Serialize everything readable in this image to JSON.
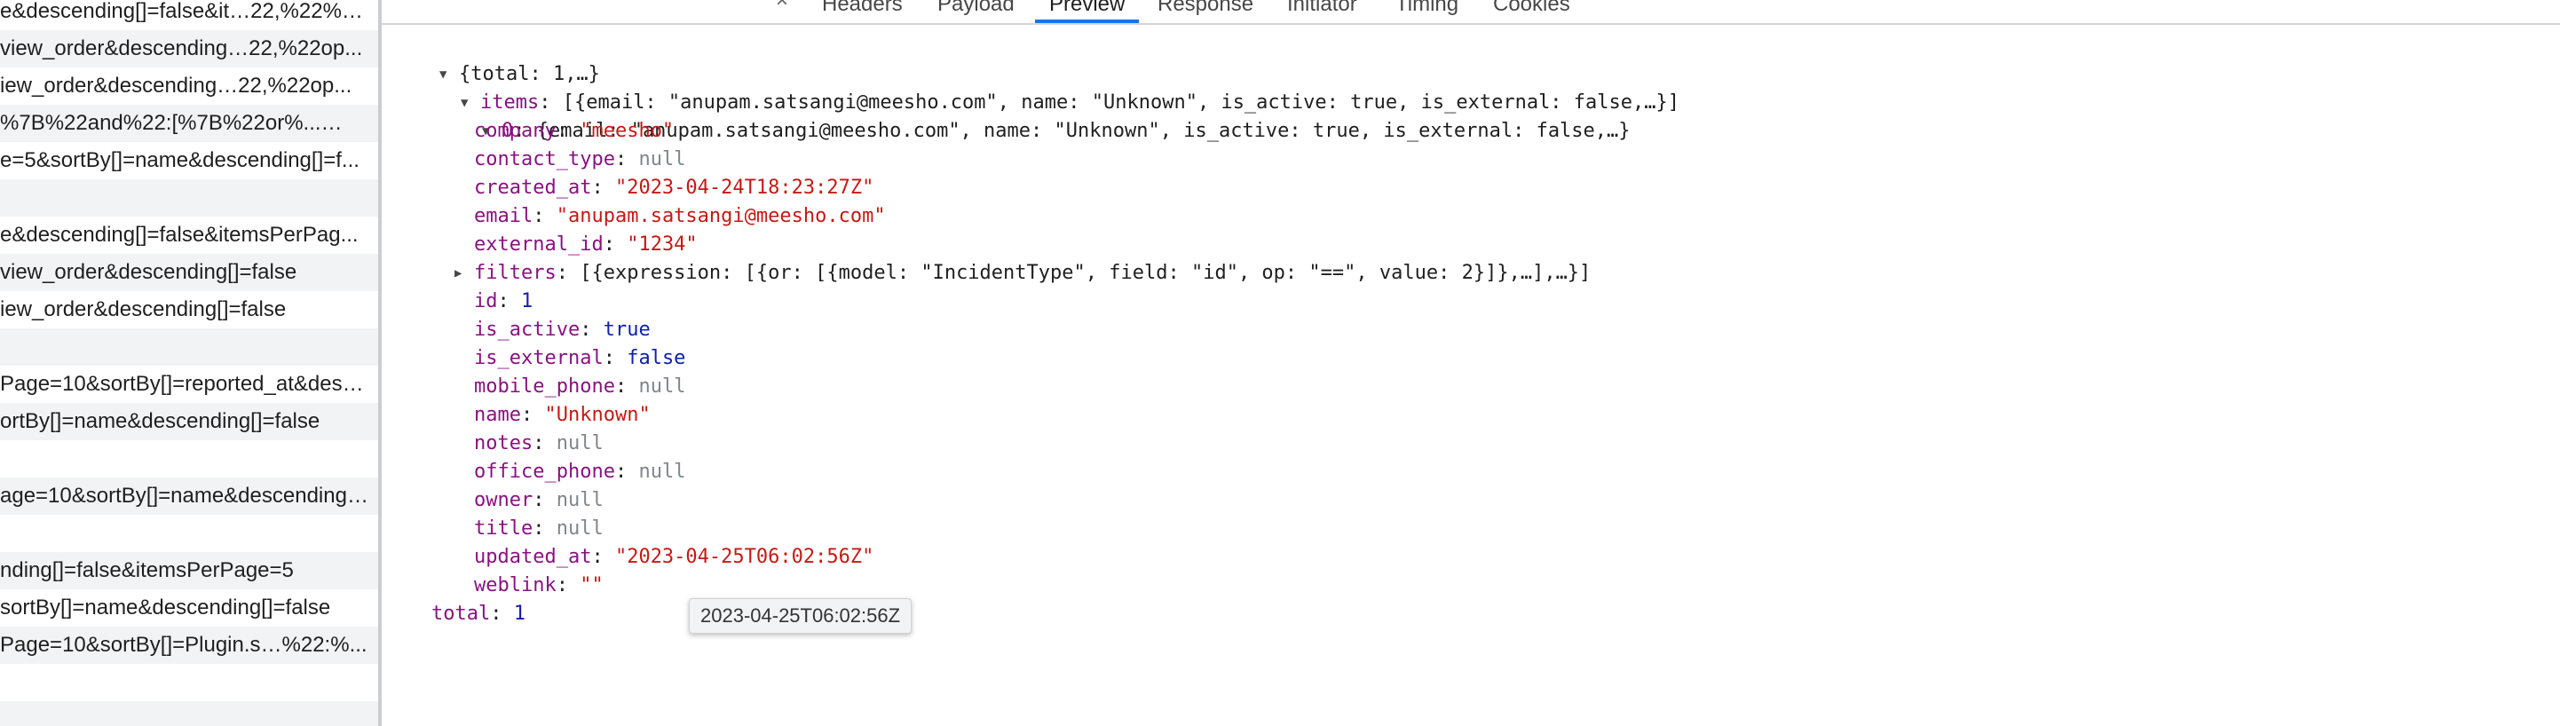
{
  "request_list": [
    {
      "text": "e&descending[]=false&it…22,%22%22%...",
      "stripe": false
    },
    {
      "text": "view_order&descending…22,%22op...",
      "stripe": true
    },
    {
      "text": "iew_order&descending…22,%22op...",
      "stripe": false
    },
    {
      "text": "%7B%22and%22:[%7B%22or%...…",
      "stripe": true
    },
    {
      "text": "e=5&sortBy[]=name&descending[]=f...",
      "stripe": false
    },
    {
      "text": "",
      "stripe": true
    },
    {
      "text": "e&descending[]=false&itemsPerPag...",
      "stripe": false
    },
    {
      "text": "view_order&descending[]=false",
      "stripe": true
    },
    {
      "text": "iew_order&descending[]=false",
      "stripe": false
    },
    {
      "text": "",
      "stripe": true
    },
    {
      "text": "Page=10&sortBy[]=reported_at&desc...",
      "stripe": false
    },
    {
      "text": "ortBy[]=name&descending[]=false",
      "stripe": true
    },
    {
      "text": "",
      "stripe": false
    },
    {
      "text": "age=10&sortBy[]=name&descending[...",
      "stripe": true
    },
    {
      "text": "",
      "stripe": false
    },
    {
      "text": "nding[]=false&itemsPerPage=5",
      "stripe": true
    },
    {
      "text": "sortBy[]=name&descending[]=false",
      "stripe": false
    },
    {
      "text": "Page=10&sortBy[]=Plugin.s…%22:%...",
      "stripe": true
    },
    {
      "text": "",
      "stripe": false
    },
    {
      "text": "",
      "stripe": true
    }
  ],
  "tabs": {
    "close": "×",
    "headers": "Headers",
    "payload": "Payload",
    "preview": "Preview",
    "response": "Response",
    "initiator": "Initiator",
    "timing": "Timing",
    "cookies": "Cookies"
  },
  "json": {
    "root_summary": "{total: 1,…}",
    "items_key": "items",
    "items_summary": "[{email: \"anupam.satsangi@meesho.com\", name: \"Unknown\", is_active: true, is_external: false,…}]",
    "item0_key": "0",
    "item0_summary": "{email: \"anupam.satsangi@meesho.com\", name: \"Unknown\", is_active: true, is_external: false,…}",
    "company": "\"meesho\"",
    "contact_type": "null",
    "created_at": "\"2023-04-24T18:23:27Z\"",
    "email": "\"anupam.satsangi@meesho.com\"",
    "external_id": "\"1234\"",
    "filters_summary": "[{expression: [{or: [{model: \"IncidentType\", field: \"id\", op: \"==\", value: 2}]},…],…}]",
    "id": "1",
    "is_active": "true",
    "is_external": "false",
    "mobile_phone": "null",
    "name": "\"Unknown\"",
    "notes": "null",
    "office_phone": "null",
    "owner": "null",
    "title": "null",
    "updated_at": "\"2023-04-25T06:02:56Z\"",
    "weblink": "\"\"",
    "total": "1"
  },
  "tooltip": "2023-04-25T06:02:56Z",
  "colors": {
    "key": "#881280",
    "string": "#c41a16",
    "number": "#1a1aa6",
    "null": "#80868b",
    "active_tab": "#1a73e8"
  }
}
